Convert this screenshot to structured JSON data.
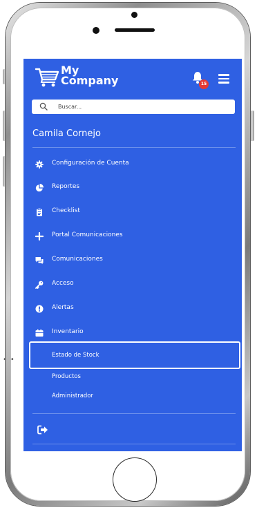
{
  "app": {
    "brand_line1": "My",
    "brand_line2": "Company",
    "notifications_count": "15"
  },
  "search": {
    "placeholder": "Buscar..."
  },
  "user": {
    "name": "Camila Cornejo"
  },
  "menu": [
    {
      "label": "Configuración de Cuenta",
      "icon": "gear-icon"
    },
    {
      "label": "Reportes",
      "icon": "pie-chart-icon"
    },
    {
      "label": "Checklist",
      "icon": "clipboard-icon"
    },
    {
      "label": "Portal Comunicaciones",
      "icon": "plus-icon"
    },
    {
      "label": "Comunicaciones",
      "icon": "chat-icon"
    },
    {
      "label": "Acceso",
      "icon": "key-icon"
    },
    {
      "label": "Alertas",
      "icon": "exclamation-icon"
    },
    {
      "label": "Inventario",
      "icon": "inventory-icon"
    }
  ],
  "inventario_submenu": [
    {
      "label": "Estado de Stock",
      "active": true
    },
    {
      "label": "Productos",
      "active": false
    },
    {
      "label": "Administrador",
      "active": false
    }
  ],
  "colors": {
    "sidebar_bg": "#2f60e3",
    "badge": "#e53935",
    "text": "#ffffff"
  }
}
